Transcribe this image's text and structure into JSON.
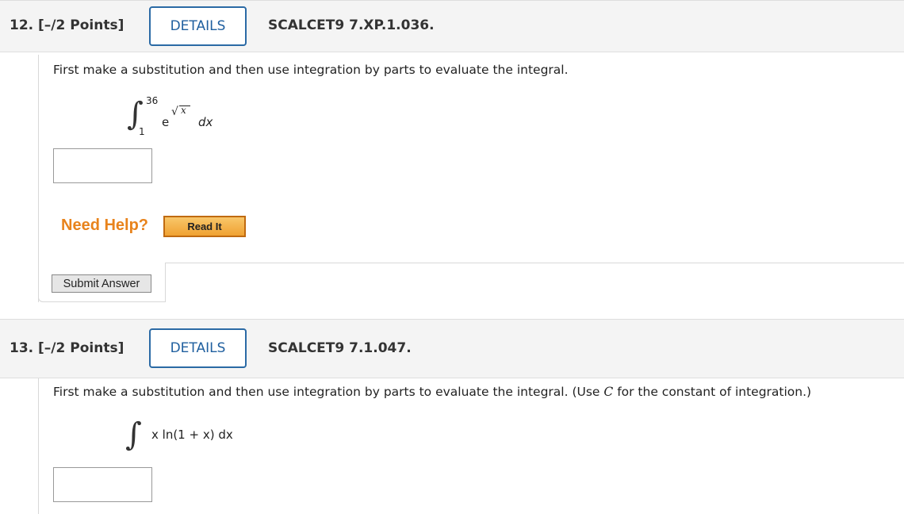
{
  "q12": {
    "number": "12.  [–/2 Points]",
    "details_label": "DETAILS",
    "code": "SCALCET9 7.XP.1.036.",
    "prompt": "First make a substitution and then use integration by parts to evaluate the integral.",
    "integral": {
      "sign": "∫",
      "upper": "36",
      "lower": "1",
      "base": "e",
      "exponent_root": "√",
      "exponent_var": "x",
      "differential": "dx"
    },
    "answer_value": "",
    "help": {
      "need_help": "Need Help?",
      "read_it": "Read It"
    },
    "submit_label": "Submit Answer"
  },
  "q13": {
    "number": "13.  [–/2 Points]",
    "details_label": "DETAILS",
    "code": "SCALCET9 7.1.047.",
    "prompt_pre": "First make a substitution and then use integration by parts to evaluate the integral. (Use ",
    "prompt_var": "C",
    "prompt_post": " for the constant of integration.)",
    "integral": {
      "sign": "∫",
      "expression": "x ln(1 + x) dx"
    },
    "answer_value": ""
  },
  "colors": {
    "accent": "#2b6aa5",
    "help": "#e8831c",
    "header_bg": "#f4f4f4"
  }
}
